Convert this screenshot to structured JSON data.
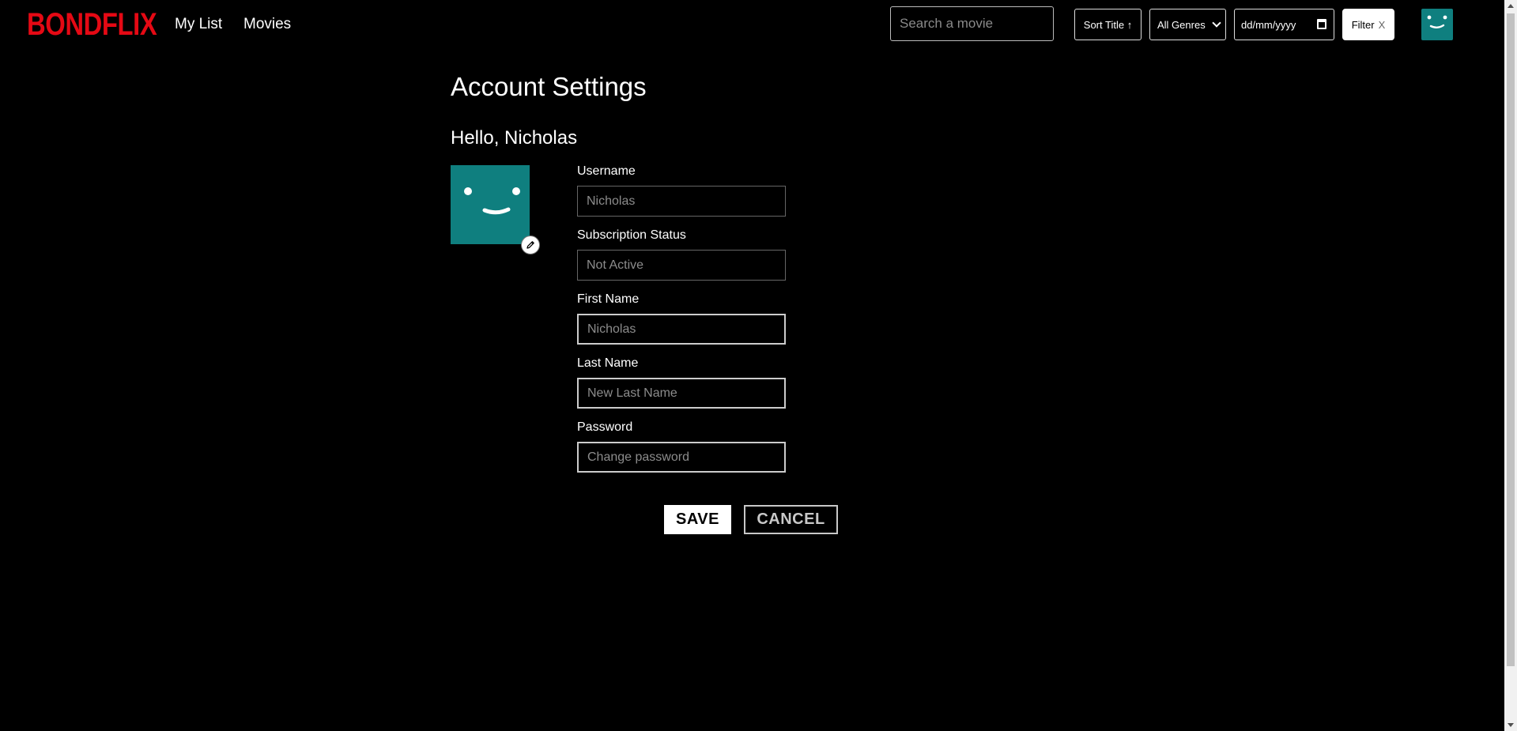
{
  "brand": {
    "logo_text": "BONDFLIX",
    "logo_color": "#e50914",
    "avatar_color": "#0f7f7f"
  },
  "nav": {
    "links": [
      {
        "label": "My List"
      },
      {
        "label": "Movies"
      }
    ],
    "search": {
      "placeholder": "Search a movie",
      "value": ""
    },
    "sort": {
      "label": "Sort Title",
      "arrow": "↑"
    },
    "genre": {
      "selected": "All Genres"
    },
    "date": {
      "placeholder": "dd/mm/yyyy"
    },
    "filter": {
      "label": "Filter",
      "clear": "X"
    },
    "profile_icon": "smiley-avatar-icon"
  },
  "main": {
    "title": "Account Settings",
    "greeting": "Hello, Nicholas",
    "avatar_icon": "smiley-avatar-icon",
    "edit_icon": "pencil-icon",
    "fields": {
      "username": {
        "label": "Username",
        "placeholder": "Nicholas",
        "disabled": true
      },
      "subscription": {
        "label": "Subscription Status",
        "placeholder": "Not Active",
        "disabled": true
      },
      "first_name": {
        "label": "First Name",
        "placeholder": "Nicholas",
        "disabled": false
      },
      "last_name": {
        "label": "Last Name",
        "placeholder": "New Last Name",
        "disabled": false
      },
      "password": {
        "label": "Password",
        "placeholder": "Change password",
        "disabled": false
      }
    },
    "actions": {
      "save_label": "SAVE",
      "cancel_label": "CANCEL"
    }
  }
}
